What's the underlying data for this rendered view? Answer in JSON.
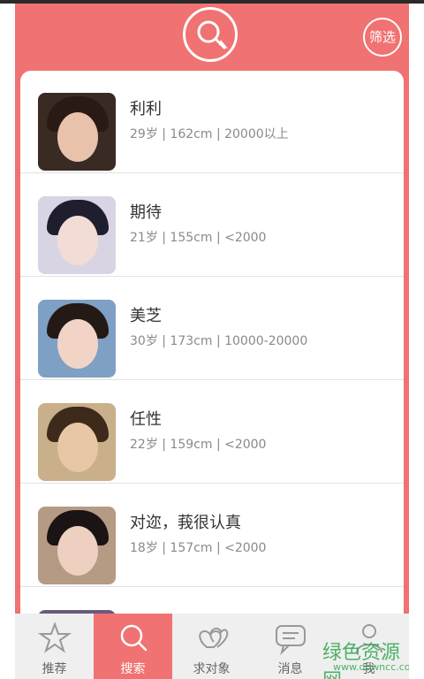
{
  "header": {
    "filter_label": "筛选"
  },
  "users": [
    {
      "name": "利利",
      "info": "29岁 | 162cm | 20000以上",
      "skin": "#e9c2ac",
      "hair": "#2b1a14",
      "bg": "#3a2a24"
    },
    {
      "name": "期待",
      "info": "21岁 | 155cm | <2000",
      "skin": "#f3dcd6",
      "hair": "#1e1e2e",
      "bg": "#d9d4e4"
    },
    {
      "name": "美芝",
      "info": "30岁 | 173cm | 10000-20000",
      "skin": "#f2d4c6",
      "hair": "#231a16",
      "bg": "#7ea0c4"
    },
    {
      "name": "任性",
      "info": "22岁 | 159cm | <2000",
      "skin": "#e8c7a6",
      "hair": "#3d2a1a",
      "bg": "#c9b08a"
    },
    {
      "name": "对迩，莪很认真",
      "info": "18岁 | 157cm | <2000",
      "skin": "#edd0c0",
      "hair": "#1a1414",
      "bg": "#b59a84"
    },
    {
      "name": "",
      "info": "",
      "skin": "#e0c0b0",
      "hair": "#2a2020",
      "bg": "#6b5a7a"
    }
  ],
  "tabs": [
    {
      "label": "推荐",
      "icon": "star-icon"
    },
    {
      "label": "搜索",
      "icon": "search-icon"
    },
    {
      "label": "求对象",
      "icon": "hearts-icon"
    },
    {
      "label": "消息",
      "icon": "message-icon"
    },
    {
      "label": "我",
      "icon": "person-icon"
    }
  ],
  "active_tab": "搜索",
  "watermark": {
    "text": "绿色资源网",
    "url": "www.downcc.com"
  },
  "colors": {
    "accent": "#f07272",
    "tabbar": "#efefef",
    "watermark": "#2fa84f"
  }
}
